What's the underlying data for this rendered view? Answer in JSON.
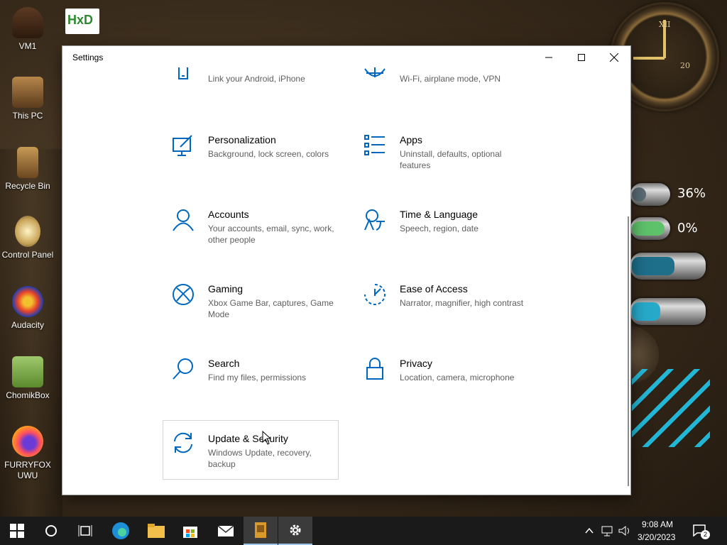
{
  "desktop": {
    "icons": [
      {
        "label": "VM1"
      },
      {
        "label": "This PC"
      },
      {
        "label": "Recycle Bin"
      },
      {
        "label": "Control Panel"
      },
      {
        "label": "Audacity"
      },
      {
        "label": "ChomikBox"
      },
      {
        "label": "FURRYFOX UWU"
      }
    ],
    "gauges": {
      "top": "36%",
      "bottom": "0%"
    },
    "clock": {
      "numerals": [
        "XII",
        "20"
      ]
    },
    "hxd_icon": "HxD"
  },
  "window": {
    "title": "Settings",
    "controls": {
      "minimize": "minimize-icon",
      "maximize": "maximize-icon",
      "close": "close-icon"
    },
    "tiles": [
      {
        "name": "",
        "desc": "Link your Android, iPhone",
        "icon": "phone-icon"
      },
      {
        "name": "",
        "desc": "Wi-Fi, airplane mode, VPN",
        "icon": "globe-icon"
      },
      {
        "name": "Personalization",
        "desc": "Background, lock screen, colors",
        "icon": "personalization-icon"
      },
      {
        "name": "Apps",
        "desc": "Uninstall, defaults, optional features",
        "icon": "apps-icon"
      },
      {
        "name": "Accounts",
        "desc": "Your accounts, email, sync, work, other people",
        "icon": "accounts-icon"
      },
      {
        "name": "Time & Language",
        "desc": "Speech, region, date",
        "icon": "time-language-icon"
      },
      {
        "name": "Gaming",
        "desc": "Xbox Game Bar, captures, Game Mode",
        "icon": "xbox-icon"
      },
      {
        "name": "Ease of Access",
        "desc": "Narrator, magnifier, high contrast",
        "icon": "ease-of-access-icon"
      },
      {
        "name": "Search",
        "desc": "Find my files, permissions",
        "icon": "search-icon"
      },
      {
        "name": "Privacy",
        "desc": "Location, camera, microphone",
        "icon": "lock-icon"
      },
      {
        "name": "Update & Security",
        "desc": "Windows Update, recovery, backup",
        "icon": "update-icon"
      }
    ]
  },
  "taskbar": {
    "apps": [
      "start",
      "search",
      "task-view",
      "edge",
      "file-explorer",
      "store",
      "mail",
      "app",
      "settings"
    ],
    "tray": {
      "time": "9:08 AM",
      "date": "3/20/2023",
      "notifications": "2"
    }
  },
  "colors": {
    "accent": "#0067c0",
    "taskbar": "#1a1a1a"
  }
}
